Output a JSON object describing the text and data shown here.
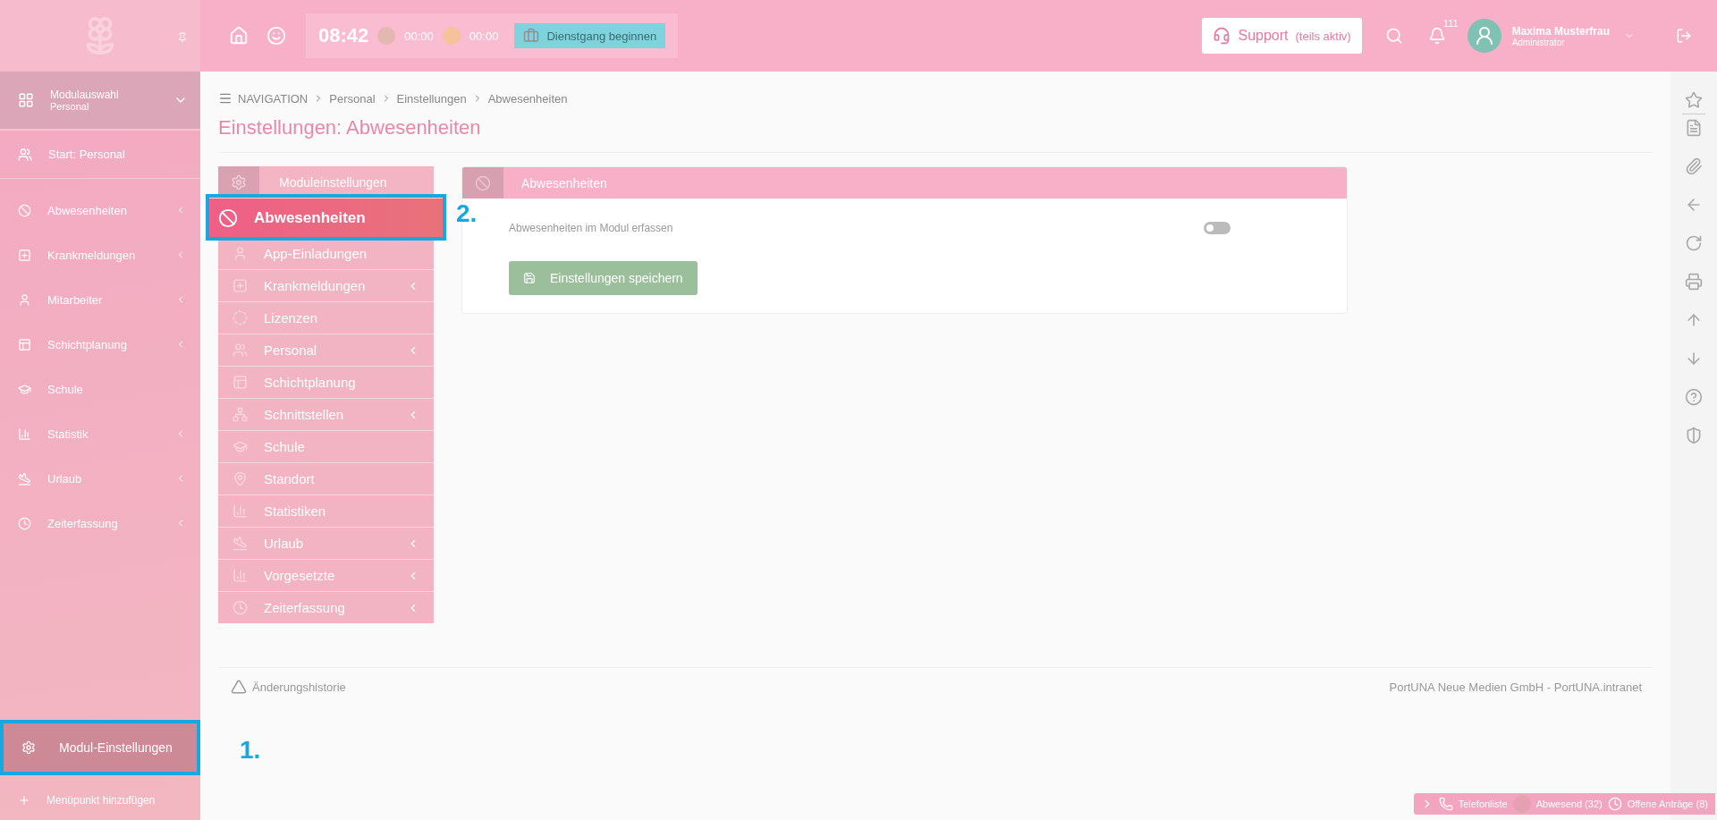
{
  "topbar": {
    "time": "08:42",
    "break_timer": "00:00",
    "pause_timer": "00:00",
    "duty_button": "Dienstgang beginnen",
    "support_button": "Support",
    "support_note": "(teils aktiv)",
    "notification_count": "111",
    "user_name": "Maxima Musterfrau",
    "user_role": "Administrator"
  },
  "sidebar": {
    "module_select": {
      "title": "Modulauswahl",
      "subtitle": "Personal"
    },
    "start": "Start: Personal",
    "items": [
      {
        "label": "Abwesenheiten",
        "has_submenu": true
      },
      {
        "label": "Krankmeldungen",
        "has_submenu": true
      },
      {
        "label": "Mitarbeiter",
        "has_submenu": true
      },
      {
        "label": "Schichtplanung",
        "has_submenu": true
      },
      {
        "label": "Schule",
        "has_submenu": false
      },
      {
        "label": "Statistik",
        "has_submenu": true
      },
      {
        "label": "Urlaub",
        "has_submenu": true
      },
      {
        "label": "Zeiterfassung",
        "has_submenu": true
      }
    ],
    "settings_item": {
      "label": "Modul-Einstellungen",
      "highlighted": true,
      "callout": "1."
    },
    "add_item": "Menüpunkt hinzufügen"
  },
  "breadcrumb": [
    "NAVIGATION",
    "Personal",
    "Einstellungen",
    "Abwesenheiten"
  ],
  "page_title": "Einstellungen: Abwesenheiten",
  "module_menu": {
    "title": "Moduleinstellungen",
    "items": [
      {
        "label": "Abwesenheiten",
        "selected": true,
        "has_submenu": false,
        "highlighted": true,
        "callout": "2."
      },
      {
        "label": "App-Einladungen",
        "selected": false,
        "has_submenu": false,
        "highlighted": false
      },
      {
        "label": "Krankmeldungen",
        "selected": false,
        "has_submenu": true,
        "highlighted": false
      },
      {
        "label": "Lizenzen",
        "selected": false,
        "has_submenu": false,
        "highlighted": false
      },
      {
        "label": "Personal",
        "selected": false,
        "has_submenu": true,
        "highlighted": false
      },
      {
        "label": "Schichtplanung",
        "selected": false,
        "has_submenu": false,
        "highlighted": false
      },
      {
        "label": "Schnittstellen",
        "selected": false,
        "has_submenu": true,
        "highlighted": false
      },
      {
        "label": "Schule",
        "selected": false,
        "has_submenu": false,
        "highlighted": false
      },
      {
        "label": "Standort",
        "selected": false,
        "has_submenu": false,
        "highlighted": false
      },
      {
        "label": "Statistiken",
        "selected": false,
        "has_submenu": false,
        "highlighted": false
      },
      {
        "label": "Urlaub",
        "selected": false,
        "has_submenu": true,
        "highlighted": false
      },
      {
        "label": "Vorgesetzte",
        "selected": false,
        "has_submenu": true,
        "highlighted": false
      },
      {
        "label": "Zeiterfassung",
        "selected": false,
        "has_submenu": true,
        "highlighted": false
      }
    ]
  },
  "panel": {
    "title": "Abwesenheiten",
    "setting": {
      "label": "Abwesenheiten im Modul erfassen",
      "on": false
    },
    "save_button": "Einstellungen speichern"
  },
  "footer": {
    "history_link": "Änderungshistorie",
    "copyright": "PortUNA Neue Medien GmbH - PortUNA.intranet"
  },
  "status_bar": {
    "phone_list": "Telefonliste",
    "absent": "Abwesend (32)",
    "open_requests": "Offene Anträge (8)"
  }
}
